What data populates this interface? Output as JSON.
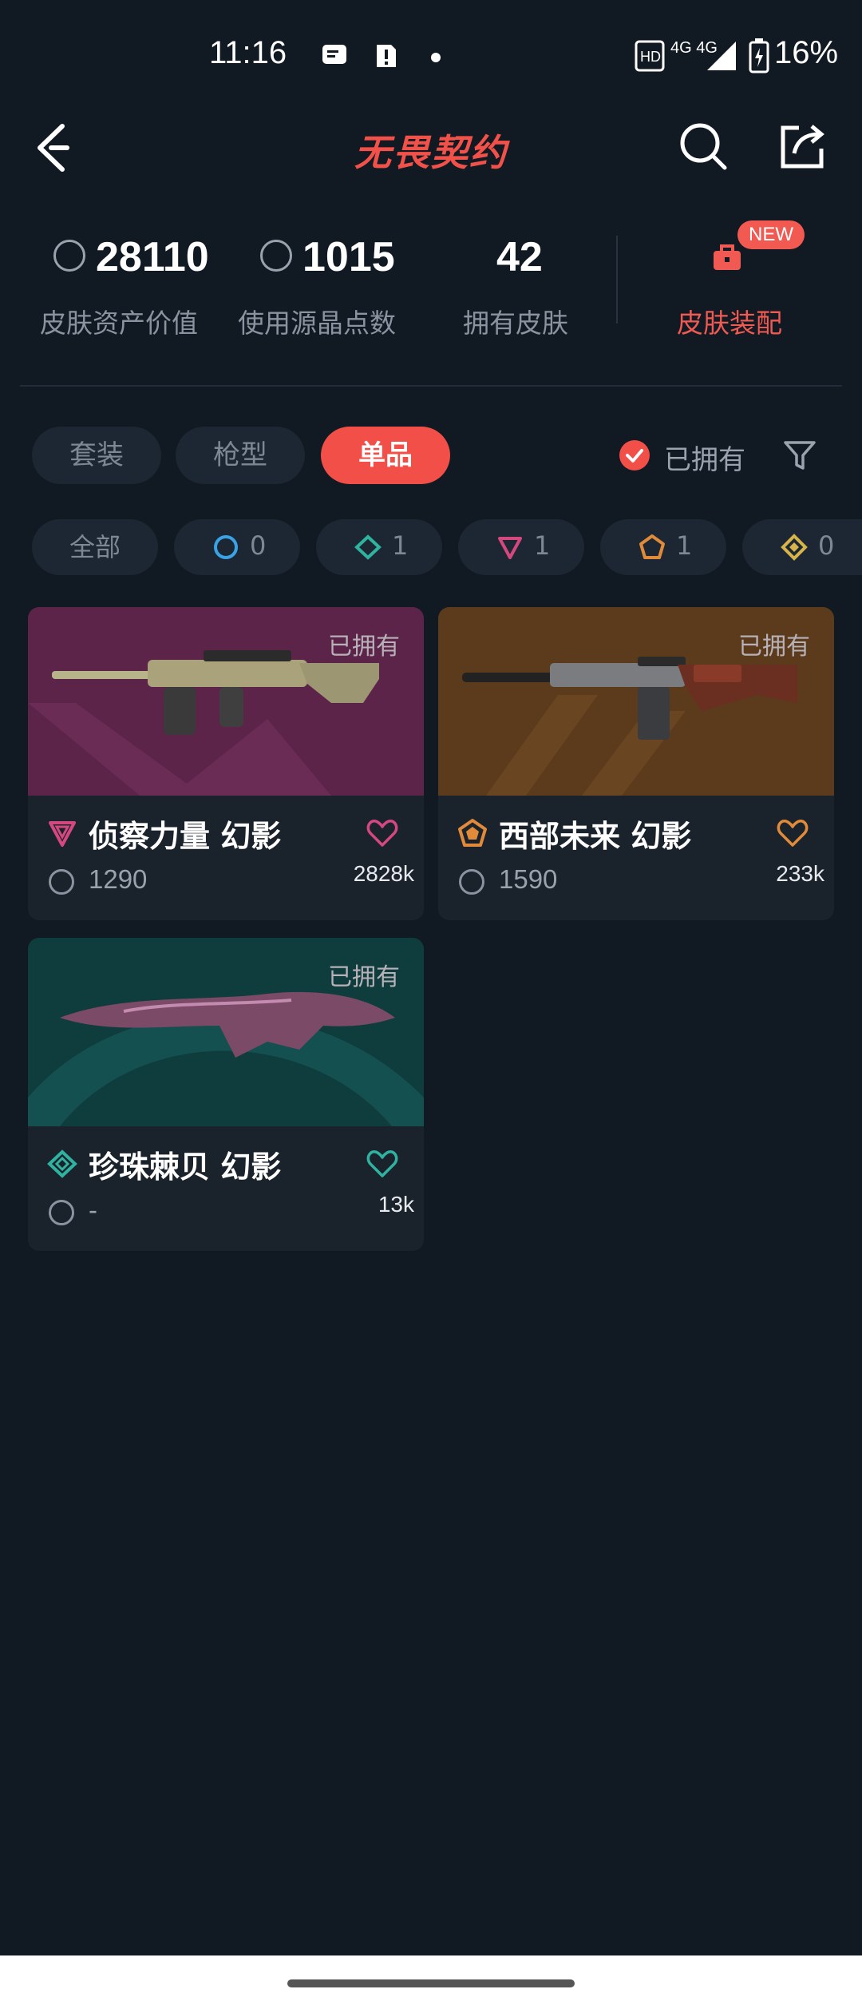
{
  "status_bar": {
    "time": "11:16",
    "network": "4G 4G",
    "battery": "16%"
  },
  "header": {
    "title": "无畏契约"
  },
  "stats": [
    {
      "value": "28110",
      "label": "皮肤资产价值"
    },
    {
      "value": "1015",
      "label": "使用源晶点数"
    },
    {
      "value": "42",
      "label": "拥有皮肤"
    }
  ],
  "equip": {
    "badge": "NEW",
    "label": "皮肤装配"
  },
  "tabs": [
    "套装",
    "枪型",
    "单品"
  ],
  "owned_filter": {
    "label": "已拥有",
    "checked": true
  },
  "chips": [
    {
      "label": "全部"
    },
    {
      "count": "0",
      "color": "#3aa3e6"
    },
    {
      "count": "1",
      "color": "#2fb3a0"
    },
    {
      "count": "1",
      "color": "#d4487f"
    },
    {
      "count": "1",
      "color": "#e08a3a"
    },
    {
      "count": "0",
      "color": "#d8b34a"
    }
  ],
  "cards": [
    {
      "owned": "已拥有",
      "name": "侦察力量 幻影",
      "price": "1290",
      "likes": "2828k",
      "rarity_color": "#d4487f"
    },
    {
      "owned": "已拥有",
      "name": "西部未来 幻影",
      "price": "1590",
      "likes": "233k",
      "rarity_color": "#e08a3a"
    },
    {
      "owned": "已拥有",
      "name": "珍珠棘贝 幻影",
      "price": "-",
      "likes": "13k",
      "rarity_color": "#2fb3a0"
    }
  ],
  "colors": {
    "accent": "#f14f47",
    "background": "#111923"
  }
}
